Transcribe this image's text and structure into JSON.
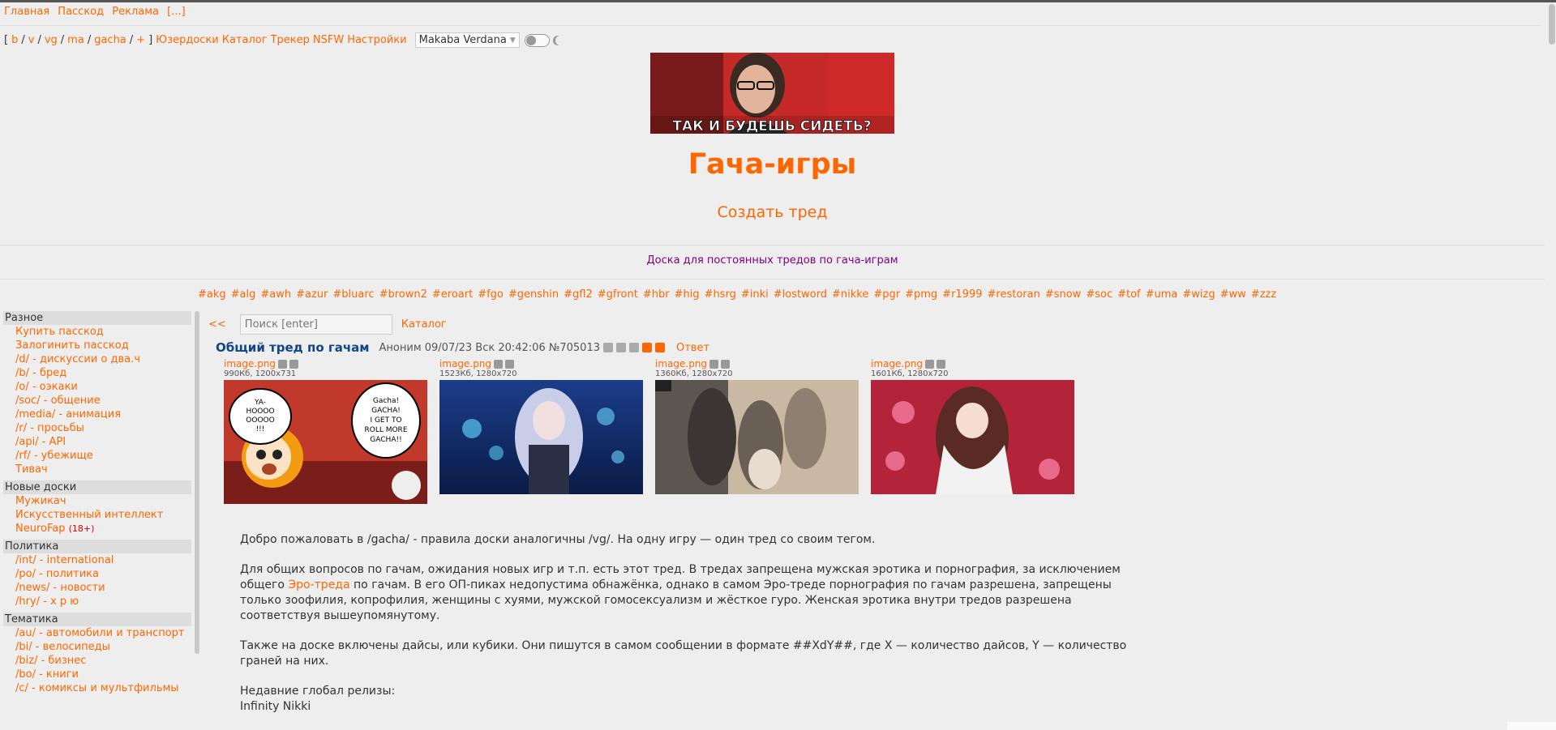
{
  "topnav": [
    "Главная",
    "Пасскод",
    "Реклама",
    "[...]"
  ],
  "boards_bar": {
    "open": "[",
    "items": [
      "b",
      "v",
      "vg",
      "ma",
      "gacha",
      "+"
    ],
    "close": "]",
    "links": [
      "Юзердоски",
      "Каталог",
      "Трекер",
      "NSFW",
      "Настройки"
    ],
    "font_select": "Makaba Verdana"
  },
  "banner_caption": "ТАК И БУДЕШЬ СИДЕТЬ?",
  "board_title": "Гача-игры",
  "create_thread": "Создать тред",
  "board_description": "Доска для постоянных тредов по гача-играм",
  "tags": [
    "#akg",
    "#alg",
    "#awh",
    "#azur",
    "#bluarc",
    "#brown2",
    "#eroart",
    "#fgo",
    "#genshin",
    "#gfl2",
    "#gfront",
    "#hbr",
    "#hig",
    "#hsrg",
    "#inki",
    "#lostword",
    "#nikke",
    "#pgr",
    "#pmg",
    "#r1999",
    "#restoran",
    "#snow",
    "#soc",
    "#tof",
    "#uma",
    "#wizg",
    "#ww",
    "#zzz"
  ],
  "sidebar": [
    {
      "title": "Разное",
      "items": [
        "Купить пасскод",
        "Залогинить пасскод",
        "/d/ - дискуссии о два.ч",
        "/b/ - бред",
        "/o/ - оэкаки",
        "/soc/ - общение",
        "/media/ - анимация",
        "/r/ - просьбы",
        "/api/ - API",
        "/rf/ - убежище",
        "Тивач"
      ]
    },
    {
      "title": "Новые доски",
      "items": [
        "Мужикач",
        "Искусственный интеллект",
        "NeuroFap"
      ],
      "badge": "(18+)"
    },
    {
      "title": "Политика",
      "items": [
        "/int/ - international",
        "/po/ - политика",
        "/news/ - новости",
        "/hry/ - х р ю"
      ]
    },
    {
      "title": "Тематика",
      "items": [
        "/au/ - автомобили и транспорт",
        "/bi/ - велосипеды",
        "/biz/ - бизнес",
        "/bo/ - книги",
        "/c/ - комиксы и мультфильмы"
      ]
    }
  ],
  "thread_bar": {
    "back": "<<",
    "search_placeholder": "Поиск [enter]",
    "catalog": "Каталог"
  },
  "post": {
    "subject": "Общий тред по гачам",
    "meta": "Аноним  09/07/23 Вск 20:42:06 №705013",
    "reply": "Ответ",
    "files": [
      {
        "name": "image.png",
        "info": "990Кб, 1200x731",
        "bubble1": "YA-HOOOOOOOOOOOOOOOOOO!!!",
        "bubble2": "Gacha! GACHA! I GET TO ROLL MORE GACHA!!"
      },
      {
        "name": "image.png",
        "info": "1523Кб, 1280x720"
      },
      {
        "name": "image.png",
        "info": "1360Кб, 1280x720"
      },
      {
        "name": "image.png",
        "info": "1601Кб, 1280x720"
      }
    ],
    "body": {
      "p1": "Добро пожаловать в /gacha/ - правила доски аналогичны /vg/. На одну игру — один тред со своим тегом.",
      "p2a": "Для общих вопросов по гачам, ожидания новых игр и т.п. есть этот тред. В тредах запрещена мужская эротика и порнография, за исключением общего ",
      "p2link": "Эро-треда",
      "p2b": "  по гачам. В его ОП-пиках недопустима обнажёнка, однако в самом Эро-треде порнография по гачам разрешена, запрещены только зоофилия, копрофилия, женщины с хуями, мужской гомосексуализм и жёсткое гуро. Женская эротика внутри тредов разрешена соответствуя вышеупомянутому.",
      "p3": "Также на доске включены дайсы, или кубики. Они пишутся в самом сообщении в формате ##XdY##, где X — количество дайсов, Y — количество граней на них.",
      "p4a": "Недавние глобал релизы:",
      "p4b": "Infinity Nikki"
    }
  }
}
